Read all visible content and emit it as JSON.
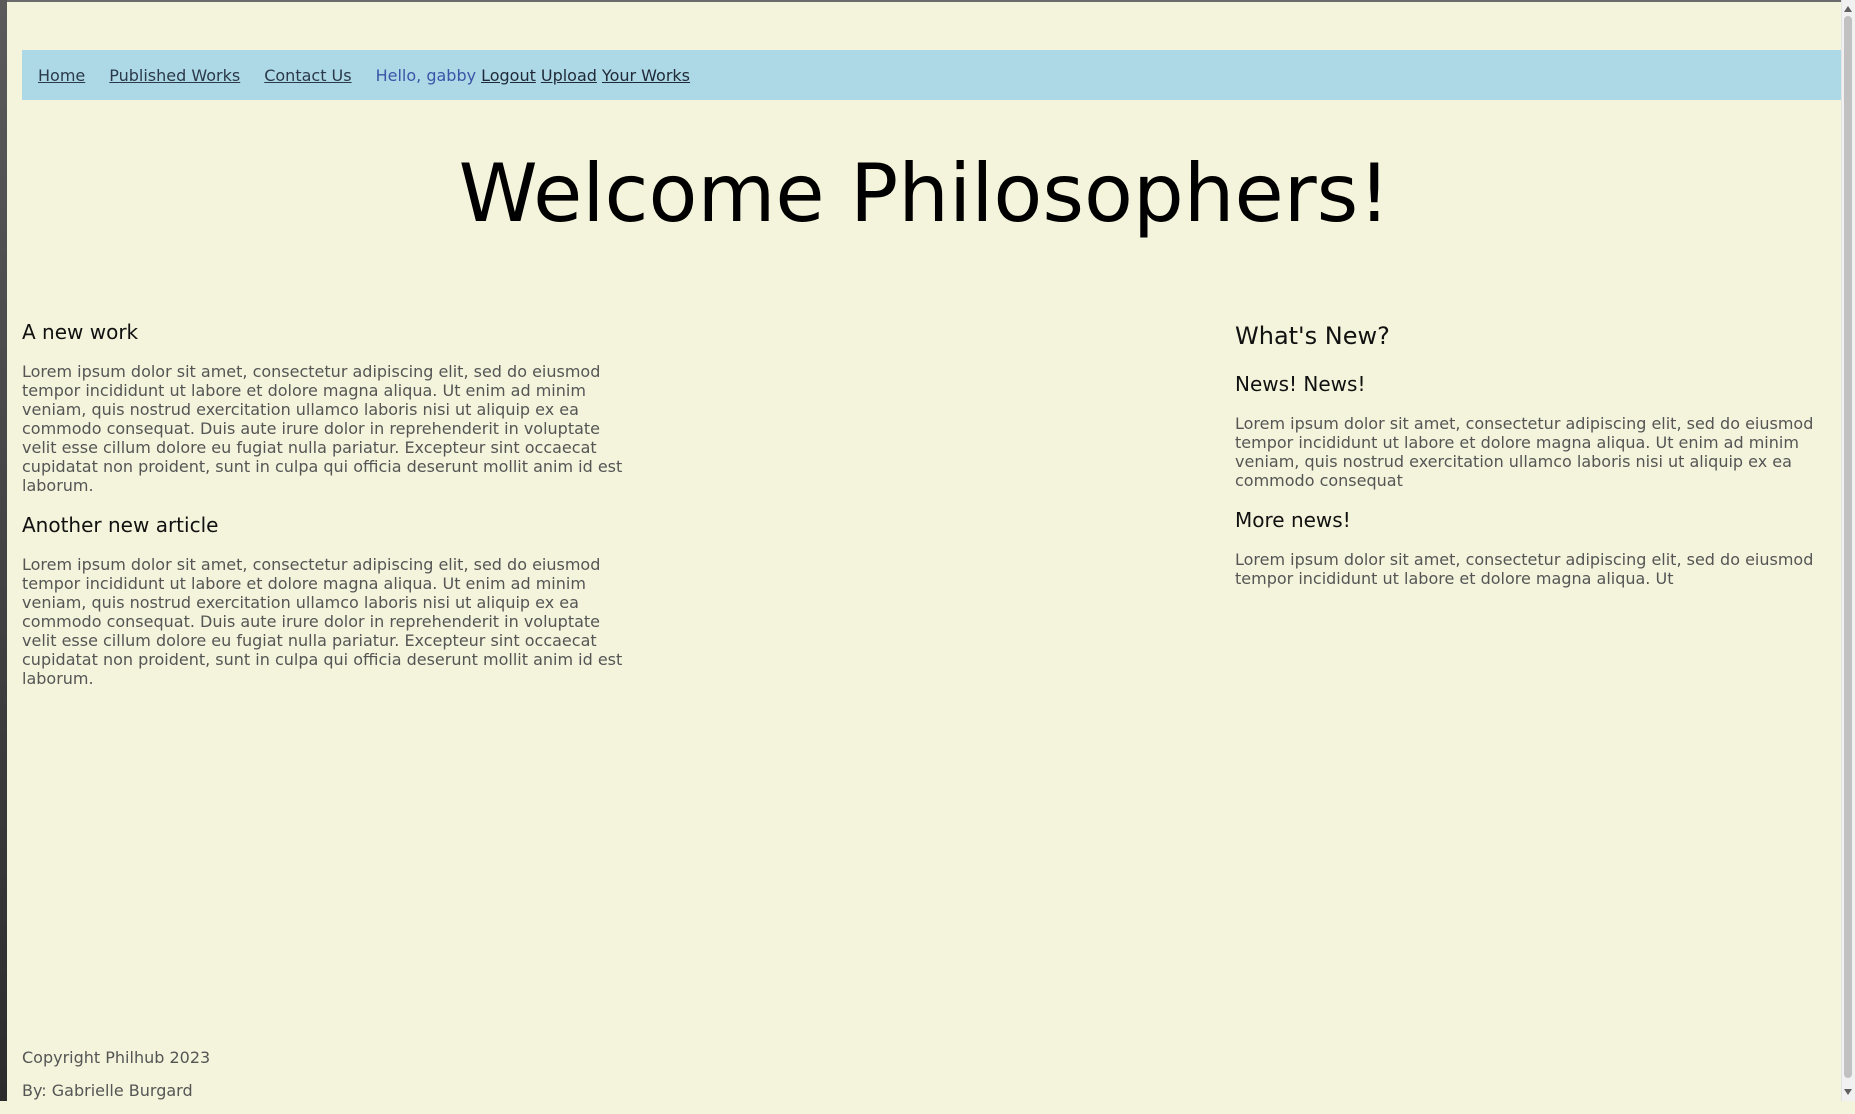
{
  "nav": {
    "links": [
      "Home",
      "Published Works",
      "Contact Us"
    ],
    "greeting": "Hello, gabby",
    "auth_links": [
      "Logout",
      "Upload",
      "Your Works"
    ]
  },
  "page": {
    "title": "Welcome Philosophers!"
  },
  "articles": [
    {
      "title": "A new work",
      "body": "Lorem ipsum dolor sit amet, consectetur adipiscing elit, sed do eiusmod tempor incididunt ut labore et dolore magna aliqua. Ut enim ad minim veniam, quis nostrud exercitation ullamco laboris nisi ut aliquip ex ea commodo consequat. Duis aute irure dolor in reprehenderit in voluptate velit esse cillum dolore eu fugiat nulla pariatur. Excepteur sint occaecat cupidatat non proident, sunt in culpa qui officia deserunt mollit anim id est laborum."
    },
    {
      "title": "Another new article",
      "body": "Lorem ipsum dolor sit amet, consectetur adipiscing elit, sed do eiusmod tempor incididunt ut labore et dolore magna aliqua. Ut enim ad minim veniam, quis nostrud exercitation ullamco laboris nisi ut aliquip ex ea commodo consequat. Duis aute irure dolor in reprehenderit in voluptate velit esse cillum dolore eu fugiat nulla pariatur. Excepteur sint occaecat cupidatat non proident, sunt in culpa qui officia deserunt mollit anim id est laborum."
    }
  ],
  "sidebar": {
    "title": "What's New?",
    "items": [
      {
        "title": "News! News!",
        "body": "Lorem ipsum dolor sit amet, consectetur adipiscing elit, sed do eiusmod tempor incididunt ut labore et dolore magna aliqua. Ut enim ad minim veniam, quis nostrud exercitation ullamco laboris nisi ut aliquip ex ea commodo consequat"
      },
      {
        "title": "More news!",
        "body": "Lorem ipsum dolor sit amet, consectetur adipiscing elit, sed do eiusmod tempor incididunt ut labore et dolore magna aliqua. Ut"
      }
    ]
  },
  "footer": {
    "copyright": "Copyright Philhub 2023",
    "author": "By: Gabrielle Burgard"
  },
  "colors": {
    "background": "#f4f4dc",
    "nav_background": "#add8e6",
    "greeting": "#3a55a8"
  }
}
